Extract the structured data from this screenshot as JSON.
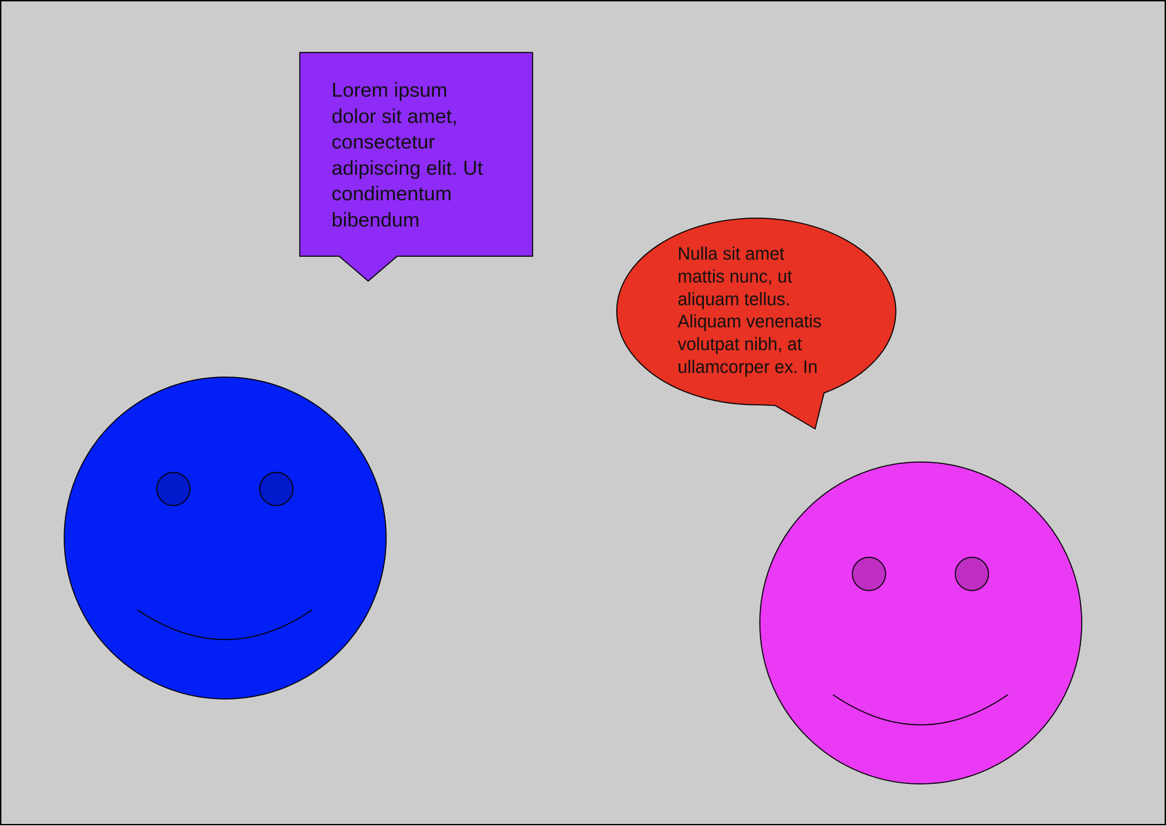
{
  "colors": {
    "canvas": "#cccccc",
    "border": "#000000",
    "rect_bubble": "#8e2bf7",
    "oval_bubble": "#e83223",
    "face_left": "#0220f5",
    "face_left_eyes": "#0219cc",
    "face_right": "#ea3af5",
    "face_right_eyes": "#bf2fc4",
    "text": "#111111"
  },
  "bubbles": {
    "rect": {
      "lines": [
        "Lorem ipsum",
        "dolor sit amet,",
        "consectetur",
        "adipiscing elit. Ut",
        "condimentum",
        "bibendum"
      ]
    },
    "oval": {
      "lines": [
        "Nulla sit amet",
        "mattis nunc, ut",
        "aliquam tellus.",
        "Aliquam venenatis",
        "volutpat nibh, at",
        "ullamcorper ex. In"
      ]
    }
  }
}
